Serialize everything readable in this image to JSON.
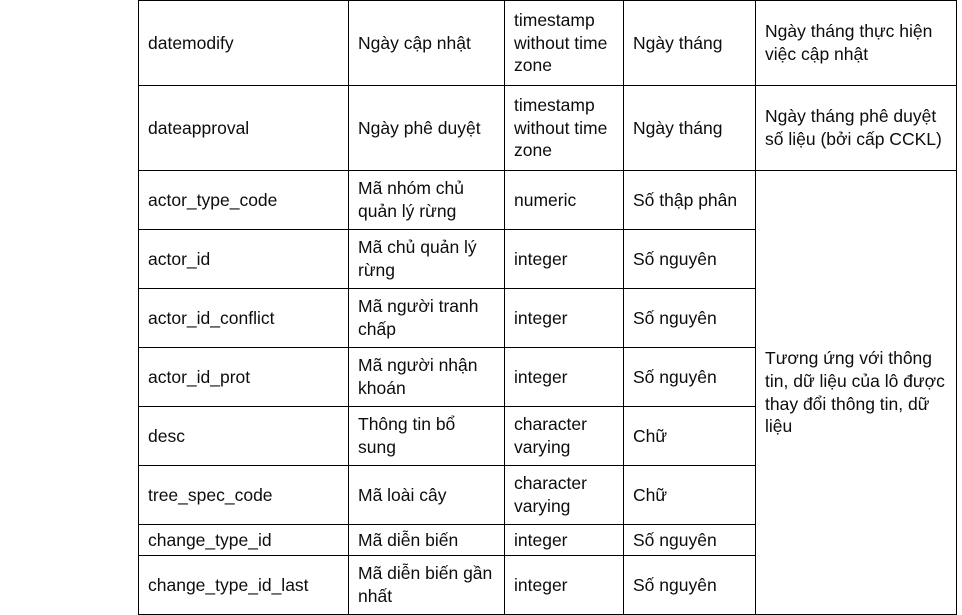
{
  "document": {
    "type": "database-schema-table",
    "language": "vi",
    "background_color": "#ffffff",
    "text_color": "#0d0d0d",
    "border_color": "#000000"
  },
  "table": {
    "column_count": 5,
    "rows": [
      {
        "name": "datemodify",
        "vi_name": "Ngày cập nhật",
        "data_type": "timestamp without time zone",
        "vi_type": "Ngày tháng",
        "note": "Ngày tháng thực hiện việc cập nhật"
      },
      {
        "name": "dateapproval",
        "vi_name": "Ngày phê duyệt",
        "data_type": "timestamp without time zone",
        "vi_type": "Ngày tháng",
        "note": "Ngày tháng phê duyệt số liệu (bởi cấp CCKL)"
      },
      {
        "name": "actor_type_code",
        "vi_name": "Mã nhóm chủ quản lý rừng",
        "data_type": "numeric",
        "vi_type": "Số thập phân"
      },
      {
        "name": "actor_id",
        "vi_name": "Mã chủ quản lý rừng",
        "data_type": "integer",
        "vi_type": "Số nguyên"
      },
      {
        "name": "actor_id_conflict",
        "vi_name": "Mã người tranh chấp",
        "data_type": "integer",
        "vi_type": "Số nguyên"
      },
      {
        "name": "actor_id_prot",
        "vi_name": "Mã người nhận khoán",
        "data_type": "integer",
        "vi_type": "Số nguyên"
      },
      {
        "name": "desc",
        "vi_name": "Thông tin bổ sung",
        "data_type": "character varying",
        "vi_type": "Chữ"
      },
      {
        "name": "tree_spec_code",
        "vi_name": "Mã loài cây",
        "data_type": "character varying",
        "vi_type": "Chữ"
      },
      {
        "name": "change_type_id",
        "vi_name": "Mã diễn biến",
        "data_type": "integer",
        "vi_type": "Số nguyên"
      },
      {
        "name": "change_type_id_last",
        "vi_name": "Mã diễn biến gần nhất",
        "data_type": "integer",
        "vi_type": "Số nguyên"
      }
    ],
    "merged_note": "Tương ứng với thông tin, dữ liệu của lô được thay đổi thông tin, dữ liệu"
  }
}
